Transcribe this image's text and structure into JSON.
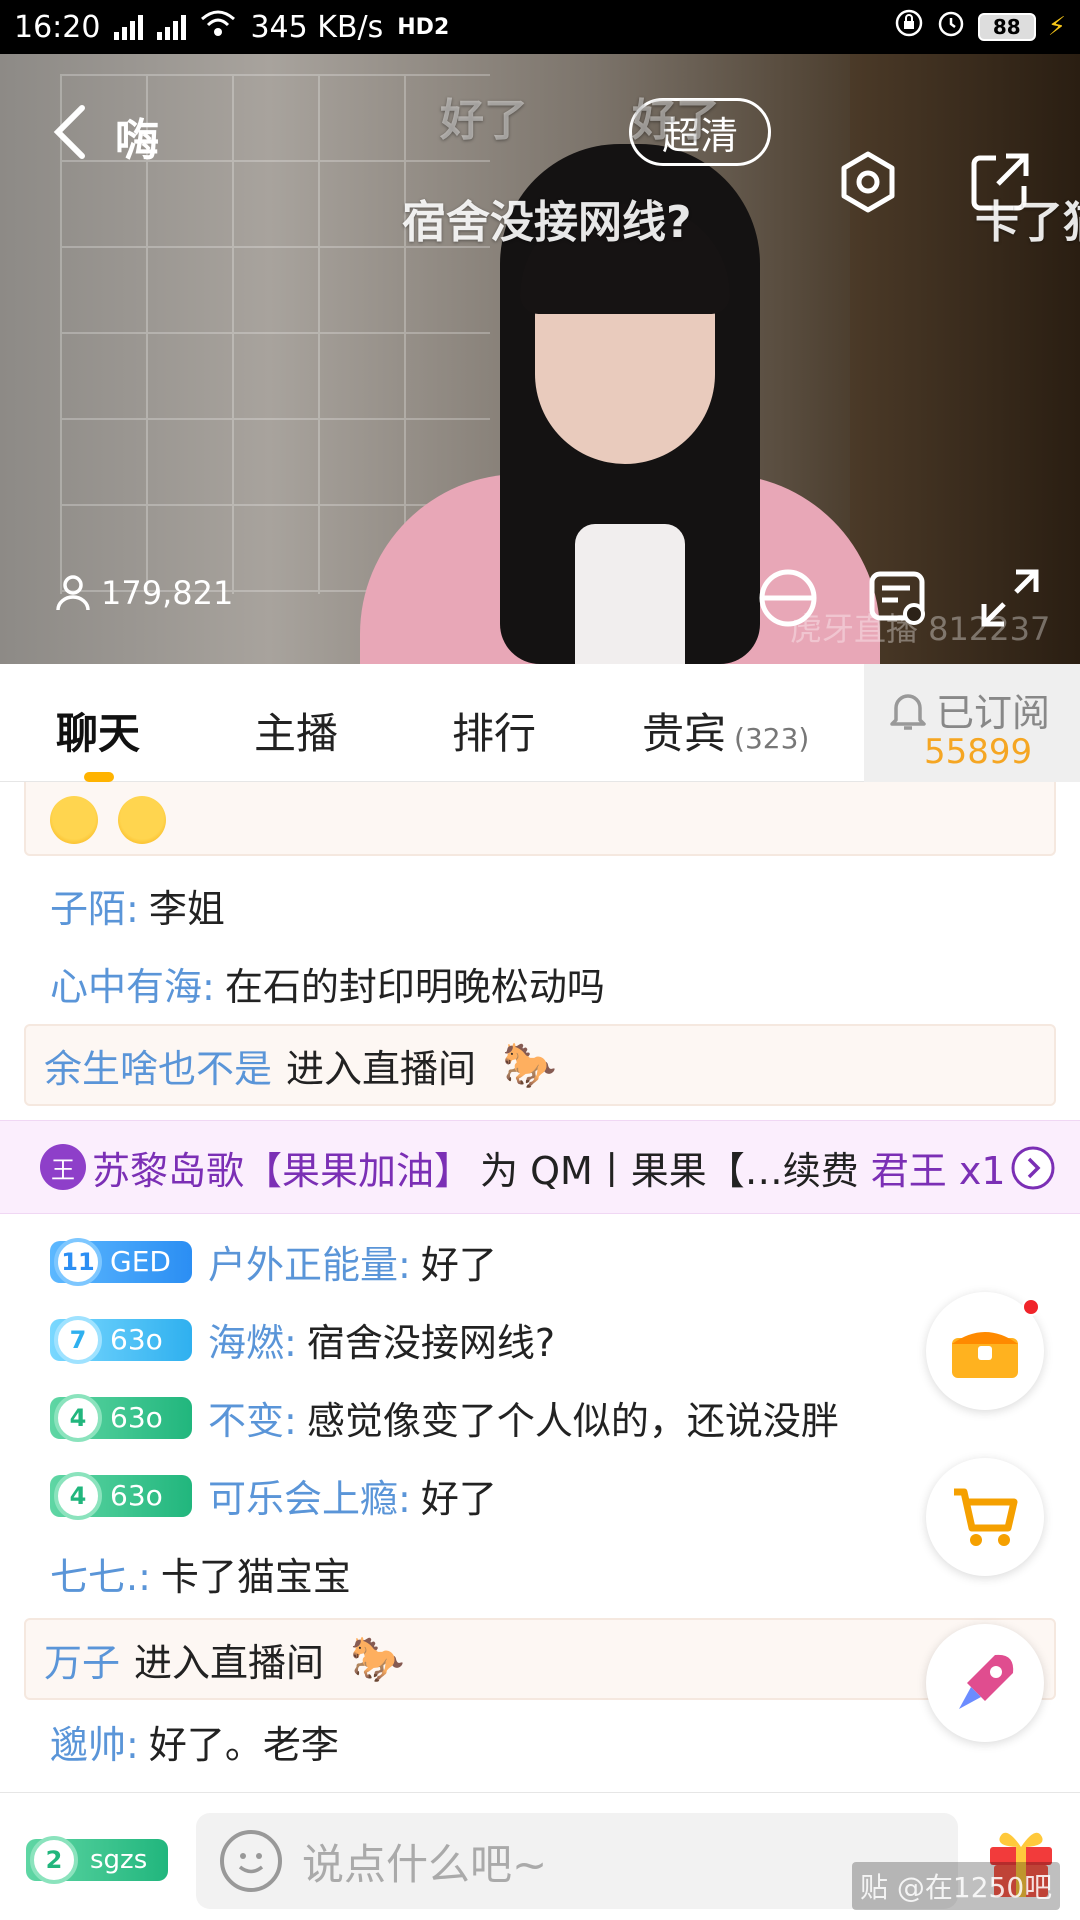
{
  "status_bar": {
    "time": "16:20",
    "net_speed": "345 KB/s",
    "battery": "88"
  },
  "video": {
    "title": "嗨",
    "quality": "超清",
    "viewers": "179,821",
    "watermark": "虎牙直播 812237",
    "danmu": [
      {
        "text": "好了",
        "faded": true
      },
      {
        "text": "好了",
        "faded": true
      },
      {
        "text": "宿舍没接网线?"
      },
      {
        "text": "卡了猫"
      }
    ]
  },
  "tabs": {
    "items": [
      "聊天",
      "主播",
      "排行",
      "贵宾"
    ],
    "vip_count": "(323)",
    "subscribe_label": "已订阅",
    "subscribe_count": "55899"
  },
  "chat": {
    "lines": [
      {
        "name": "子陌:",
        "text": "李姐"
      },
      {
        "name": "心中有海:",
        "text": "在石的封印明晚松动吗"
      }
    ],
    "enter1": {
      "name": "余生啥也不是",
      "text": "进入直播间"
    },
    "gift_bar": {
      "user": "苏黎岛歌【果果加油】",
      "mid": "为 QM丨果果【…续费",
      "gift": "君王 x1",
      "badge_char": "王"
    },
    "badged": [
      {
        "level": "11",
        "tag": "GED",
        "name": "户外正能量:",
        "text": "好了",
        "color": "blue"
      },
      {
        "level": "7",
        "tag": "63o",
        "name": "海燃:",
        "text": "宿舍没接网线?",
        "color": "cyan"
      },
      {
        "level": "4",
        "tag": "63o",
        "name": "不变:",
        "text": "感觉像变了个人似的，还说没胖",
        "color": "green"
      },
      {
        "level": "4",
        "tag": "63o",
        "name": "可乐会上瘾:",
        "text": "好了",
        "color": "green"
      }
    ],
    "line_after": {
      "name": "七七.:",
      "text": "卡了猫宝宝"
    },
    "enter2": {
      "name": "万子",
      "text": "进入直播间"
    },
    "last": {
      "name": "邈帅:",
      "text": "好了。老李"
    }
  },
  "bottom": {
    "fan_level": "2",
    "fan_tag": "sgzs",
    "input_placeholder": "说点什么吧~",
    "corner_mark": "贴 @在1250吧"
  },
  "colors": {
    "accent": "#ffb300",
    "name_blue": "#5a95d8",
    "gift_purple": "#7b2fb5",
    "subscribe_orange": "#f5a623"
  }
}
